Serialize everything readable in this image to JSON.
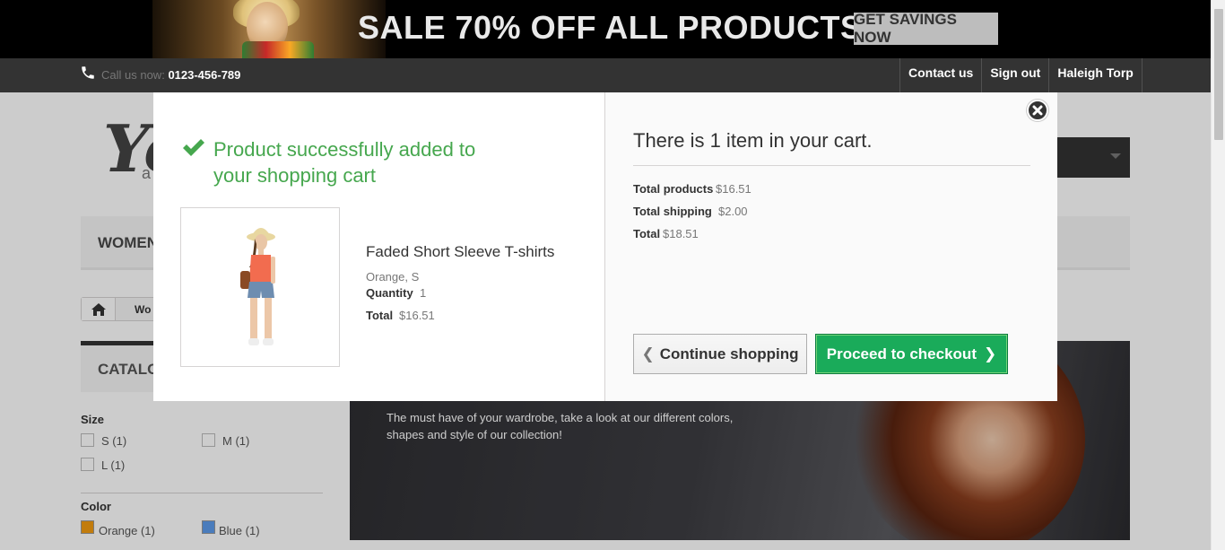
{
  "banner": {
    "headline": "SALE 70% OFF ALL PRODUCTS",
    "cta": "GET SAVINGS NOW"
  },
  "topbar": {
    "call_label": "Call us now:",
    "phone": "0123-456-789",
    "links": [
      "Contact us",
      "Sign out",
      "Haleigh Torp"
    ]
  },
  "page": {
    "logo_text": "Yo",
    "logo_sub": "a",
    "menu_first": "WOMEN",
    "breadcrumb_text": "Wo",
    "catalog_title": "CATALOG",
    "filters": {
      "size_label": "Size",
      "sizes": [
        "S (1)",
        "M (1)",
        "L (1)"
      ],
      "color_label": "Color",
      "colors": [
        {
          "label": "Orange (1)",
          "swatch": "#f39c11"
        },
        {
          "label": "Blue (1)",
          "swatch": "#5d9cec"
        }
      ]
    },
    "hero_text": "The must have of your wardrobe, take a look at our different colors, shapes and style of our collection!"
  },
  "modal": {
    "success_message": "Product successfully added to your shopping cart",
    "product": {
      "name": "Faded Short Sleeve T-shirts",
      "attributes": "Orange, S",
      "quantity_label": "Quantity",
      "quantity": "1",
      "total_label": "Total",
      "total": "$16.51"
    },
    "cart_count_text": "There is 1 item in your cart.",
    "totals": {
      "products_label": "Total products",
      "products": "$16.51",
      "shipping_label": "Total shipping",
      "shipping": "$2.00",
      "total_label": "Total",
      "total": "$18.51"
    },
    "continue_label": "Continue shopping",
    "checkout_label": "Proceed to checkout"
  },
  "colors": {
    "success_green": "#46a74e",
    "checkout_button": "#1aab5a",
    "topbar": "#333333"
  },
  "icons": [
    "phone-icon",
    "home-icon",
    "check-icon",
    "close-icon",
    "chevron-left-icon",
    "chevron-right-icon"
  ]
}
